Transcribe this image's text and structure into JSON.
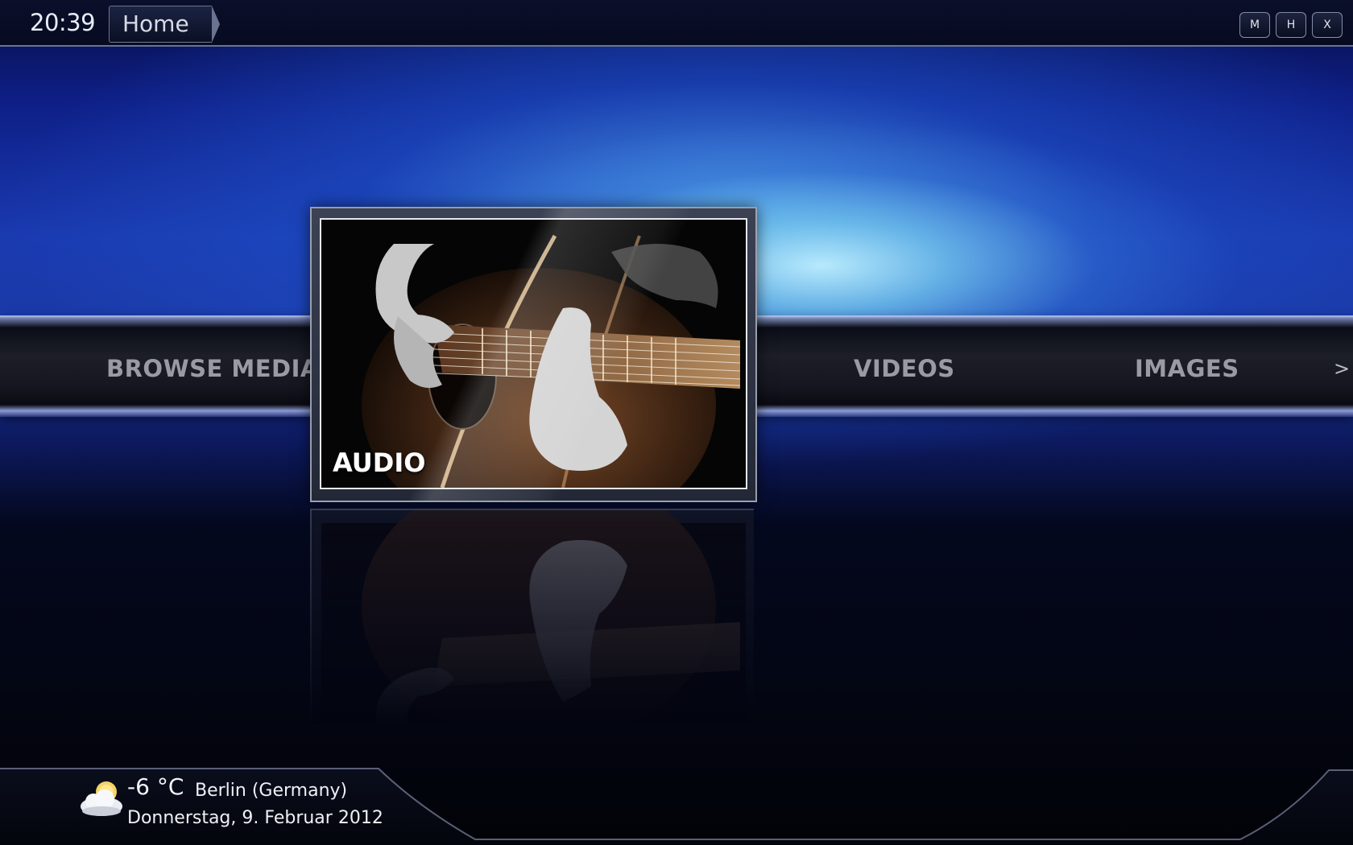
{
  "topbar": {
    "clock": "20:39",
    "breadcrumb": "Home",
    "buttons": [
      "M",
      "H",
      "X"
    ]
  },
  "menu": {
    "items": [
      "BROWSE MEDIA",
      "VIDEOS",
      "IMAGES"
    ],
    "selected_caption": "AUDIO",
    "next_arrow": ">"
  },
  "weather": {
    "temperature": "-6 °C",
    "location": "Berlin (Germany)",
    "date": "Donnerstag, 9. Februar 2012",
    "icon": "partly-cloudy-icon"
  },
  "colors": {
    "accent_glow": "#9fdcf5",
    "text_dim": "#9a9aa6"
  }
}
